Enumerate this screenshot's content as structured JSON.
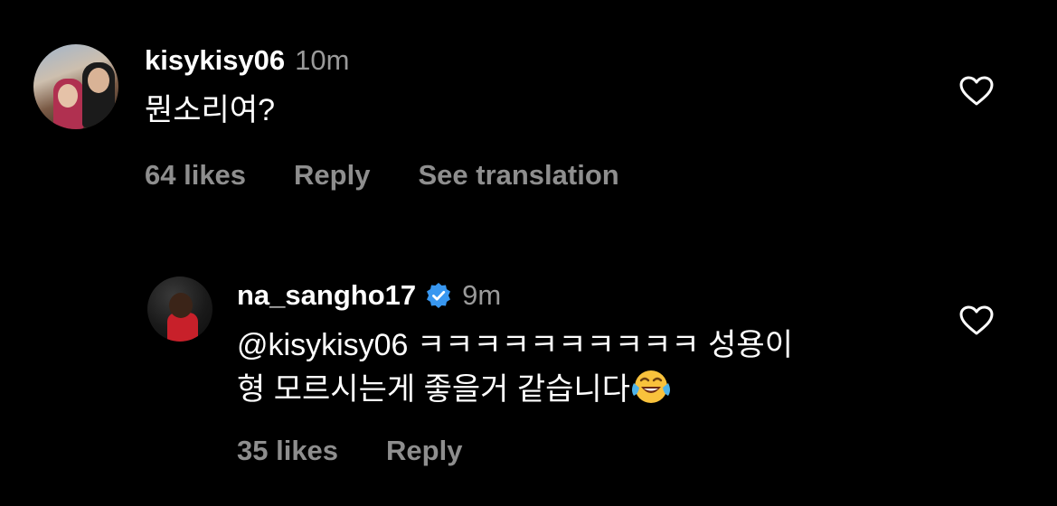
{
  "comments": [
    {
      "username": "kisykisy06",
      "time": "10m",
      "verified": false,
      "text_lines": [
        "뭔소리여?"
      ],
      "likes": "64 likes",
      "reply": "Reply",
      "translate": "See translation",
      "avatar_icon": "profile-photo",
      "like_icon": "heart-outline-icon"
    },
    {
      "username": "na_sangho17",
      "time": "9m",
      "verified": true,
      "verified_icon": "verified-badge-icon",
      "text_lines": [
        "@kisykisy06 ㅋㅋㅋㅋㅋㅋㅋㅋㅋㅋ 성용이",
        "형 모르시는게 좋을거 같습니다"
      ],
      "emoji": "face-with-tears-of-joy",
      "likes": "35 likes",
      "reply": "Reply",
      "avatar_icon": "profile-photo",
      "like_icon": "heart-outline-icon"
    }
  ],
  "colors": {
    "background": "#000000",
    "primary_text": "#ffffff",
    "secondary_text": "#8e8e8e",
    "verified_blue": "#3897f0"
  }
}
